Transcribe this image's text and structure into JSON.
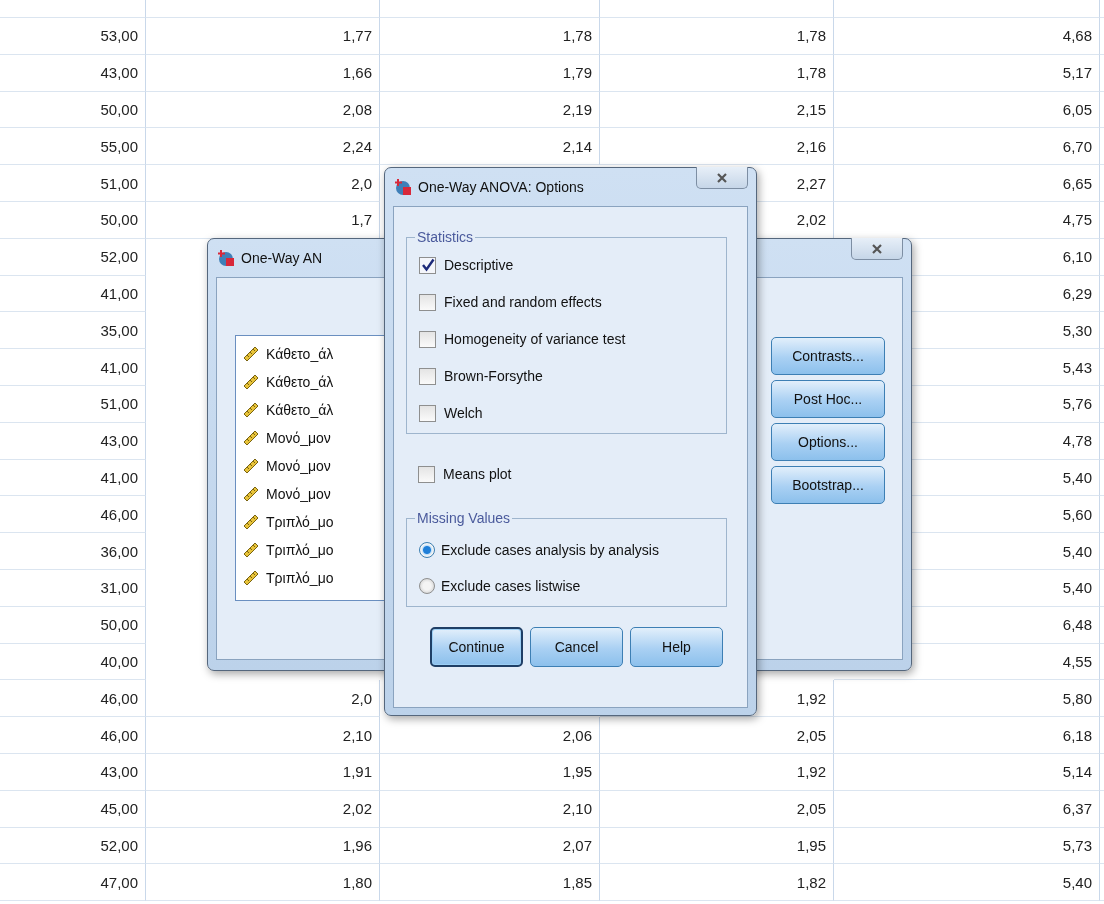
{
  "grid": {
    "rows": [
      {
        "cells": [
          "53,00",
          "1,77",
          "1,78",
          "1,78",
          "4,68"
        ]
      },
      {
        "cells": [
          "43,00",
          "1,66",
          "1,79",
          "1,78",
          "5,17"
        ]
      },
      {
        "cells": [
          "50,00",
          "2,08",
          "2,19",
          "2,15",
          "6,05"
        ]
      },
      {
        "cells": [
          "55,00",
          "2,24",
          "2,14",
          "2,16",
          "6,70"
        ]
      },
      {
        "cells": [
          "51,00",
          "2,0",
          null,
          "2,27",
          "6,65"
        ]
      },
      {
        "cells": [
          "50,00",
          "1,7",
          null,
          "2,02",
          "4,75"
        ]
      },
      {
        "cells": [
          "52,00",
          null,
          null,
          null,
          "6,10"
        ]
      },
      {
        "cells": [
          "41,00",
          null,
          null,
          null,
          "6,29"
        ]
      },
      {
        "cells": [
          "35,00",
          null,
          null,
          null,
          "5,30"
        ]
      },
      {
        "cells": [
          "41,00",
          null,
          null,
          null,
          "5,43"
        ]
      },
      {
        "cells": [
          "51,00",
          null,
          null,
          null,
          "5,76"
        ]
      },
      {
        "cells": [
          "43,00",
          null,
          null,
          null,
          "4,78"
        ]
      },
      {
        "cells": [
          "41,00",
          null,
          null,
          null,
          "5,40"
        ]
      },
      {
        "cells": [
          "46,00",
          null,
          null,
          null,
          "5,60"
        ]
      },
      {
        "cells": [
          "36,00",
          null,
          null,
          null,
          "5,40"
        ]
      },
      {
        "cells": [
          "31,00",
          null,
          null,
          null,
          "5,40"
        ]
      },
      {
        "cells": [
          "50,00",
          null,
          null,
          null,
          "6,48"
        ]
      },
      {
        "cells": [
          "40,00",
          null,
          null,
          null,
          "4,55"
        ]
      },
      {
        "cells": [
          "46,00",
          "2,0",
          null,
          "1,92",
          "5,80"
        ]
      },
      {
        "cells": [
          "46,00",
          "2,10",
          "2,06",
          "2,05",
          "6,18"
        ]
      },
      {
        "cells": [
          "43,00",
          "1,91",
          "1,95",
          "1,92",
          "5,14"
        ]
      },
      {
        "cells": [
          "45,00",
          "2,02",
          "2,10",
          "2,05",
          "6,37"
        ]
      },
      {
        "cells": [
          "52,00",
          "1,96",
          "2,07",
          "1,95",
          "5,73"
        ]
      },
      {
        "cells": [
          "47,00",
          "1,80",
          "1,85",
          "1,82",
          "5,40"
        ]
      }
    ]
  },
  "back_dialog": {
    "title": "One-Way AN",
    "variables": [
      "Κάθετο_άλ",
      "Κάθετο_άλ",
      "Κάθετο_άλ",
      "Μονό_μον",
      "Μονό_μον",
      "Μονό_μον",
      "Τριπλό_μο",
      "Τριπλό_μο",
      "Τριπλό_μο"
    ],
    "buttons": [
      "Contrasts...",
      "Post Hoc...",
      "Options...",
      "Bootstrap..."
    ]
  },
  "options_dialog": {
    "title": "One-Way ANOVA: Options",
    "statistics": {
      "title": "Statistics",
      "options": [
        {
          "label": "Descriptive",
          "checked": true
        },
        {
          "label": "Fixed and random effects",
          "checked": false
        },
        {
          "label": "Homogeneity of variance test",
          "checked": false
        },
        {
          "label": "Brown-Forsythe",
          "checked": false
        },
        {
          "label": "Welch",
          "checked": false
        }
      ]
    },
    "means_plot": {
      "label": "Means plot",
      "checked": false
    },
    "missing_values": {
      "title": "Missing Values",
      "options": [
        {
          "label": "Exclude cases analysis by analysis",
          "selected": true
        },
        {
          "label": "Exclude cases listwise",
          "selected": false
        }
      ]
    },
    "buttons": [
      {
        "label": "Continue",
        "focused": true
      },
      {
        "label": "Cancel",
        "focused": false
      },
      {
        "label": "Help",
        "focused": false
      }
    ]
  }
}
